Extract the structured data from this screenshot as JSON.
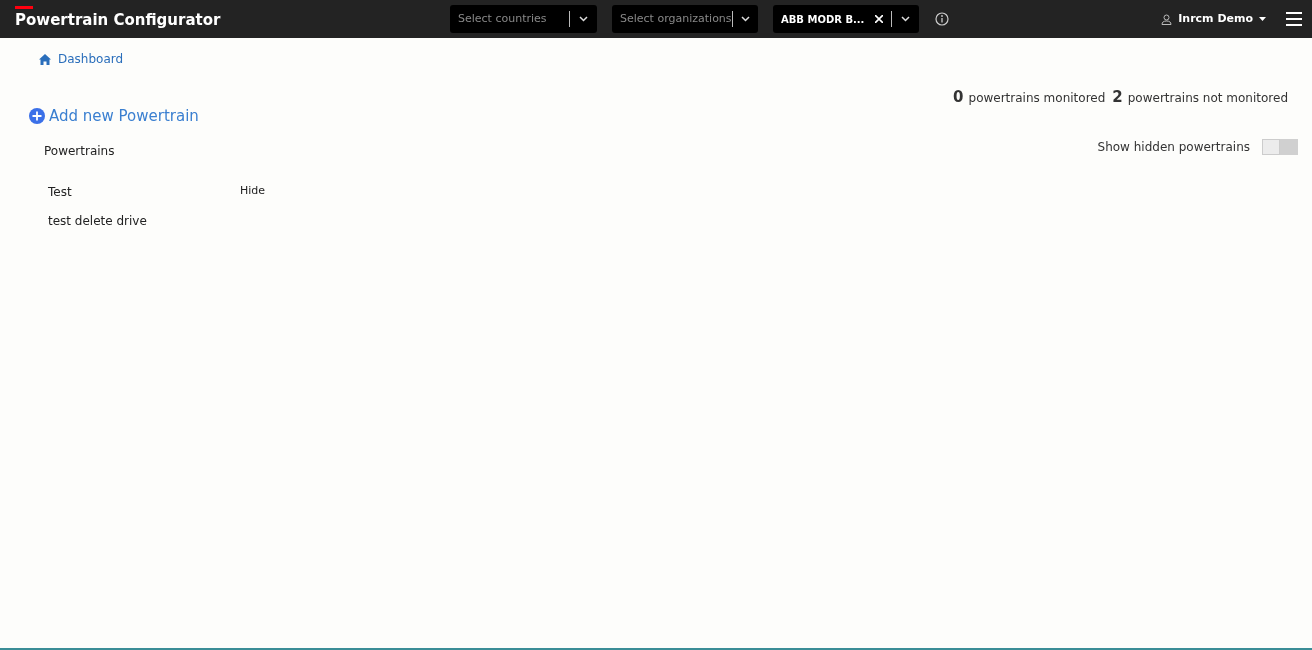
{
  "header": {
    "title": "Powertrain Configurator",
    "filters": [
      {
        "kind": "select",
        "placeholder": "Select countries"
      },
      {
        "kind": "select",
        "placeholder": "Select organizations"
      },
      {
        "kind": "value",
        "value": "ABB MODR B...",
        "clearable": true
      }
    ],
    "user": "Inrcm Demo"
  },
  "breadcrumb": "Dashboard",
  "summary": {
    "monitored_count": "0",
    "monitored_label": "powertrains monitored",
    "not_monitored_count": "2",
    "not_monitored_label": "powertrains not monitored"
  },
  "add_button": "Add new Powertrain",
  "list_title": "Powertrains",
  "show_hidden": {
    "label": "Show hidden powertrains",
    "on": false
  },
  "powertrains": [
    {
      "name": "Test",
      "action": "Hide"
    },
    {
      "name": "test delete drive"
    }
  ]
}
